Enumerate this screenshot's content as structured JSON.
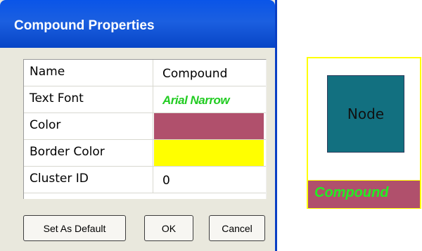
{
  "dialog": {
    "title": "Compound Properties",
    "properties": [
      {
        "label": "Name",
        "value": "Compound",
        "kind": "text"
      },
      {
        "label": "Text Font",
        "value": "Arial Narrow",
        "kind": "font",
        "color": "#22cc22"
      },
      {
        "label": "Color",
        "value": "",
        "kind": "swatch",
        "color": "#b0506c"
      },
      {
        "label": "Border Color",
        "value": "",
        "kind": "swatch",
        "color": "#ffff00"
      },
      {
        "label": "Cluster ID",
        "value": "0",
        "kind": "text"
      }
    ],
    "buttons": {
      "set_default": "Set As Default",
      "ok": "OK",
      "cancel": "Cancel"
    }
  },
  "preview": {
    "node_label": "Node",
    "node_color": "#127080",
    "compound_label": "Compound",
    "compound_label_color": "#22ee22",
    "compound_color": "#b0506c",
    "border_color": "#ffff00"
  }
}
